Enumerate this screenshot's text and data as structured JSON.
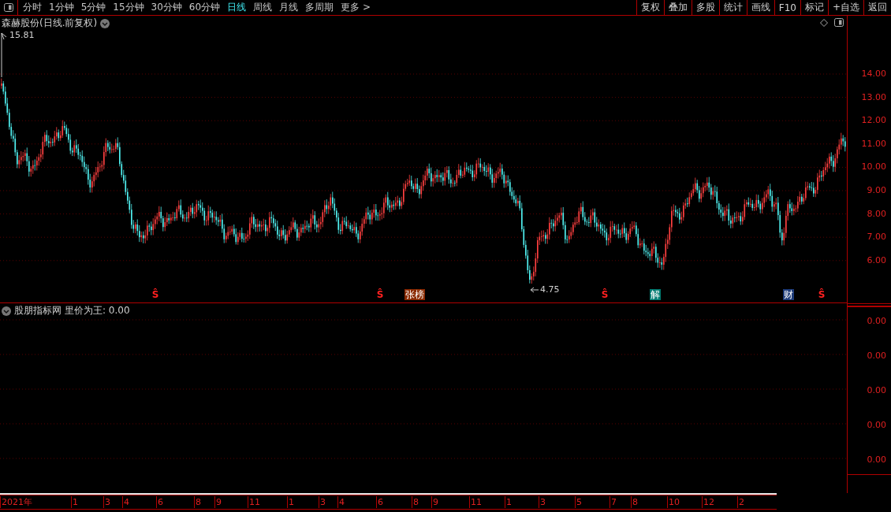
{
  "toolbar": {
    "periods": [
      {
        "label": "分时",
        "selected": false
      },
      {
        "label": "1分钟",
        "selected": false
      },
      {
        "label": "5分钟",
        "selected": false
      },
      {
        "label": "15分钟",
        "selected": false
      },
      {
        "label": "30分钟",
        "selected": false
      },
      {
        "label": "60分钟",
        "selected": false
      },
      {
        "label": "日线",
        "selected": true
      },
      {
        "label": "周线",
        "selected": false
      },
      {
        "label": "月线",
        "selected": false
      },
      {
        "label": "多周期",
        "selected": false
      },
      {
        "label": "更多 >",
        "selected": false
      }
    ],
    "buttons": [
      "复权",
      "叠加",
      "多股",
      "统计",
      "画线",
      "F10",
      "标记",
      "+自选",
      "返回"
    ]
  },
  "price_panel": {
    "title": "森赫股份(日线.前复权)",
    "high_label": "15.81",
    "low_label": "4.75",
    "price_ticks": [
      "14.00",
      "13.00",
      "12.00",
      "11.00",
      "10.00",
      "9.00",
      "8.00",
      "7.00",
      "6.00"
    ],
    "markers": [
      {
        "text": "Ŝ",
        "kind": "signal",
        "color": "#ff2020"
      },
      {
        "text": "Ŝ",
        "kind": "signal",
        "color": "#ff2020"
      },
      {
        "text": "张榜",
        "kind": "tag",
        "color": "#8a2a00"
      },
      {
        "text": "Ŝ",
        "kind": "signal",
        "color": "#ff2020"
      },
      {
        "text": "解",
        "kind": "tag",
        "color": "#007a70"
      },
      {
        "text": "财",
        "kind": "tag",
        "color": "#1c3a78"
      },
      {
        "text": "Ŝ",
        "kind": "signal",
        "color": "#ff2020"
      }
    ]
  },
  "indicator_panel": {
    "name": "股朋指标网",
    "reading": "里价为王: 0.00",
    "ticks": [
      "0.00",
      "0.00",
      "0.00",
      "0.00",
      "0.00"
    ]
  },
  "time_axis": {
    "labels": [
      "2021年",
      "1",
      "3",
      "4",
      "6",
      "8",
      "9",
      "11",
      "1",
      "3",
      "4",
      "6",
      "8",
      "9",
      "11",
      "1",
      "3",
      "5",
      "7",
      "8",
      "10",
      "12",
      "2"
    ]
  }
}
